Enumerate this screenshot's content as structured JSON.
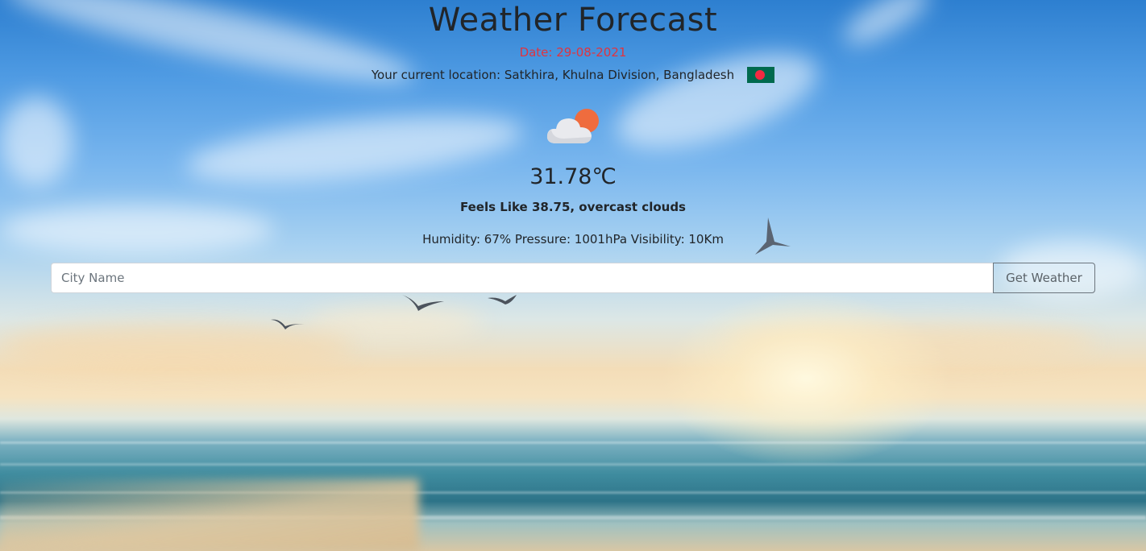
{
  "header": {
    "title": "Weather Forecast",
    "date": "Date: 29-08-2021",
    "location": "Your current location: Satkhira, Khulna Division, Bangladesh"
  },
  "current": {
    "temperature": "31.78℃",
    "feels_like": "Feels Like 38.75, overcast clouds",
    "details": "Humidity: 67% Pressure: 1001hPa Visibility: 10Km"
  },
  "search": {
    "placeholder": "City Name",
    "button_label": "Get Weather"
  },
  "icons": {
    "weather": "cloud-sun-icon",
    "flag": "bangladesh-flag-icon"
  },
  "colors": {
    "date": "#e0343f",
    "text": "#212529",
    "flag_green": "#006a4e",
    "flag_red": "#f42a41",
    "sun": "#ef6c3e"
  }
}
